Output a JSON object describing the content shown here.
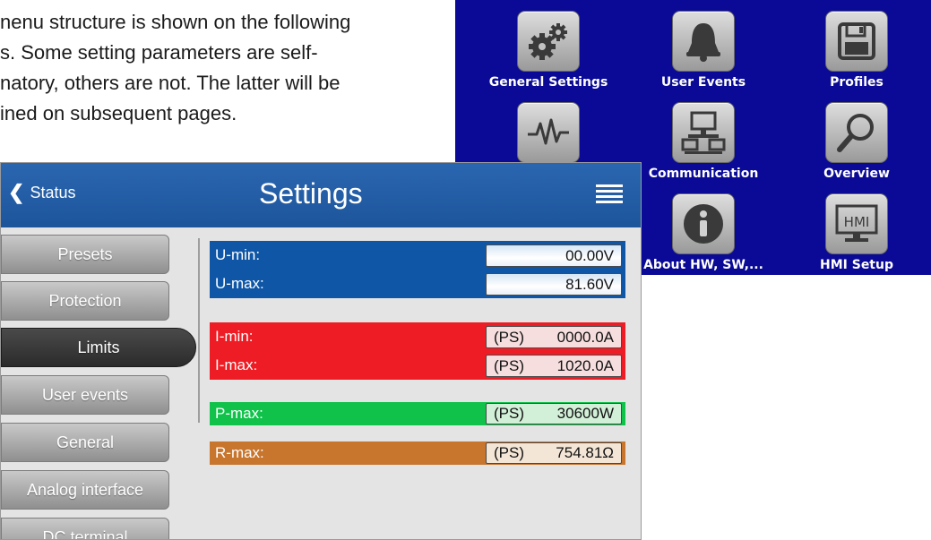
{
  "document": {
    "lines": [
      "nenu structure is shown on the following",
      "s. Some setting parameters are self-",
      "natory, others are not. The latter will be",
      "ined on subsequent pages."
    ]
  },
  "main_menu": {
    "background": "#0a0a96",
    "items": [
      {
        "label": "General Settings",
        "icon": "gears-icon"
      },
      {
        "label": "User Events",
        "icon": "bell-icon"
      },
      {
        "label": "Profiles",
        "icon": "floppy-disk-icon"
      },
      {
        "label": "",
        "icon": "waveform-icon"
      },
      {
        "label": "Communication",
        "icon": "network-icon"
      },
      {
        "label": "Overview",
        "icon": "magnifier-icon"
      },
      {
        "label": "About HW, SW,...",
        "icon": "info-icon"
      },
      {
        "label": "HMI Setup",
        "icon": "hmi-monitor-icon"
      }
    ]
  },
  "settings": {
    "header_color": "#1d559b",
    "back_label": "Status",
    "title": "Settings",
    "nav": [
      {
        "label": "Presets",
        "active": false
      },
      {
        "label": "Protection",
        "active": false
      },
      {
        "label": "Limits",
        "active": true
      },
      {
        "label": "User events",
        "active": false
      },
      {
        "label": "General",
        "active": false
      },
      {
        "label": "Analog interface",
        "active": false
      },
      {
        "label": "DC terminal",
        "active": false
      }
    ],
    "groups": {
      "voltage": {
        "color": "#0f57a6",
        "rows": [
          {
            "label": "U-min:",
            "prefix": "",
            "value": "00.00V"
          },
          {
            "label": "U-max:",
            "prefix": "",
            "value": "81.60V"
          }
        ]
      },
      "current": {
        "color": "#ee1c24",
        "rows": [
          {
            "label": "I-min:",
            "prefix": "(PS)",
            "value": "0000.0A"
          },
          {
            "label": "I-max:",
            "prefix": "(PS)",
            "value": "1020.0A"
          }
        ]
      },
      "power": {
        "color": "#10c24a",
        "rows": [
          {
            "label": "P-max:",
            "prefix": "(PS)",
            "value": "30600W"
          }
        ]
      },
      "resistance": {
        "color": "#c8752d",
        "rows": [
          {
            "label": "R-max:",
            "prefix": "(PS)",
            "value": "754.81Ω"
          }
        ]
      }
    }
  }
}
